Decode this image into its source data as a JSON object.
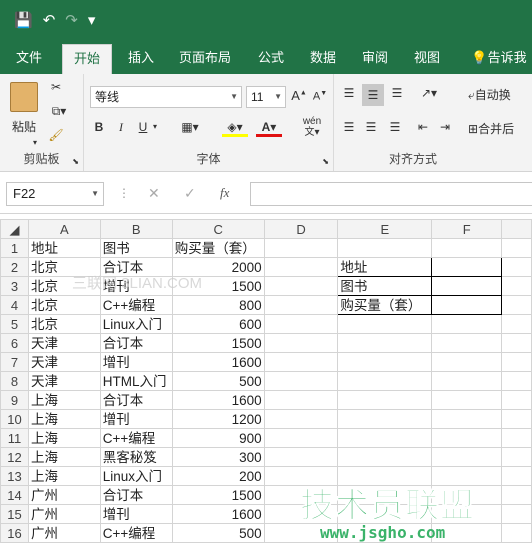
{
  "qat": {
    "save": "💾",
    "undo": "↶",
    "redo": "↷",
    "customize": "▾"
  },
  "tabs": [
    {
      "label": "文件"
    },
    {
      "label": "开始"
    },
    {
      "label": "插入"
    },
    {
      "label": "页面布局"
    },
    {
      "label": "公式"
    },
    {
      "label": "数据"
    },
    {
      "label": "审阅"
    },
    {
      "label": "视图"
    },
    {
      "label": "告诉我"
    }
  ],
  "ribbon": {
    "clipboard": {
      "label": "剪贴板",
      "paste": "粘贴"
    },
    "font": {
      "label": "字体",
      "name": "等线",
      "size": "11",
      "bold": "B",
      "italic": "I",
      "underline": "U",
      "wen": "wén"
    },
    "align": {
      "label": "对齐方式",
      "wrap": "自动换",
      "merge": "合并后"
    }
  },
  "formula_bar": {
    "name_box": "F22",
    "fx": "fx",
    "value": ""
  },
  "columns": [
    "A",
    "B",
    "C",
    "D",
    "E",
    "F"
  ],
  "rows": [
    {
      "n": "1",
      "a": "地址",
      "b": "图书",
      "c": "购买量（套）"
    },
    {
      "n": "2",
      "a": "北京",
      "b": "合订本",
      "c": "2000"
    },
    {
      "n": "3",
      "a": "北京",
      "b": "增刊",
      "c": "1500"
    },
    {
      "n": "4",
      "a": "北京",
      "b": "C++编程",
      "c": "800"
    },
    {
      "n": "5",
      "a": "北京",
      "b": "Linux入门",
      "c": "600"
    },
    {
      "n": "6",
      "a": "天津",
      "b": "合订本",
      "c": "1500"
    },
    {
      "n": "7",
      "a": "天津",
      "b": "增刊",
      "c": "1600"
    },
    {
      "n": "8",
      "a": "天津",
      "b": "HTML入门",
      "c": "500"
    },
    {
      "n": "9",
      "a": "上海",
      "b": "合订本",
      "c": "1600"
    },
    {
      "n": "10",
      "a": "上海",
      "b": "增刊",
      "c": "1200"
    },
    {
      "n": "11",
      "a": "上海",
      "b": "C++编程",
      "c": "900"
    },
    {
      "n": "12",
      "a": "上海",
      "b": "黑客秘笈",
      "c": "300"
    },
    {
      "n": "13",
      "a": "上海",
      "b": "Linux入门",
      "c": "200"
    },
    {
      "n": "14",
      "a": "广州",
      "b": "合订本",
      "c": "1500"
    },
    {
      "n": "15",
      "a": "广州",
      "b": "增刊",
      "c": "1600"
    },
    {
      "n": "16",
      "a": "广州",
      "b": "C++编程",
      "c": "500"
    }
  ],
  "criteria": [
    "地址",
    "图书",
    "购买量（套）"
  ],
  "watermark": {
    "top": "三联网 3LIAN.COM",
    "logo": "技术员联盟",
    "url": "www.jsgho.com"
  }
}
